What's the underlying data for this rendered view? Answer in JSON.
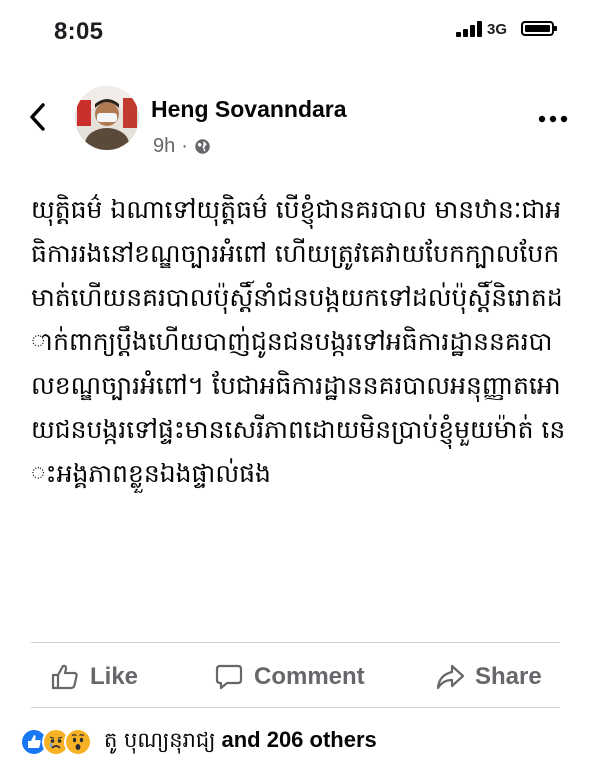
{
  "status_bar": {
    "time": "8:05",
    "network": "3G"
  },
  "post": {
    "author": "Heng Sovanndara",
    "time_ago": "9h",
    "meta_separator": "·",
    "body": "យុត្តិធម៌ ឯណាទៅយុត្តិធម៌  បើខ្ញុំជានគរបាល មានឋានៈជាអធិការរងនៅខណ្ឌច្បារអំពៅ ហើយត្រូវគេវាយបែកក្បាលបែកមាត់ហើយនគរបាលប៉ុស្តិ៍នាំជនបង្កយកទៅដល់ប៉ុស្តិ៍និរោតដាក់ពាក្យប្តឹងហើយបាញ់ជូនជនបង្ករទៅអធិការដ្ឋាននគរបាលខណ្ឌច្បារអំពៅ។ បែជាអធិការដ្ឋាននគរបាលអនុញ្ញាតអោយជនបង្ករទៅផ្ទះមានសេរីភាពដោយមិនប្រាប់ខ្ញុំមួយម៉ាត់ នេះអង្គភាពខ្លួនឯងផ្ទាល់ផង"
  },
  "actions": {
    "like": "Like",
    "comment": "Comment",
    "share": "Share"
  },
  "reactions": {
    "names": "តូ បុណ្យនុរាជ្យ",
    "others": "and 206 others",
    "icons": [
      "like-reaction",
      "sad-reaction",
      "wow-reaction"
    ]
  },
  "colors": {
    "accent_blue": "#1877f2",
    "reaction_yellow": "#f7b125",
    "secondary_text": "#65676b"
  }
}
